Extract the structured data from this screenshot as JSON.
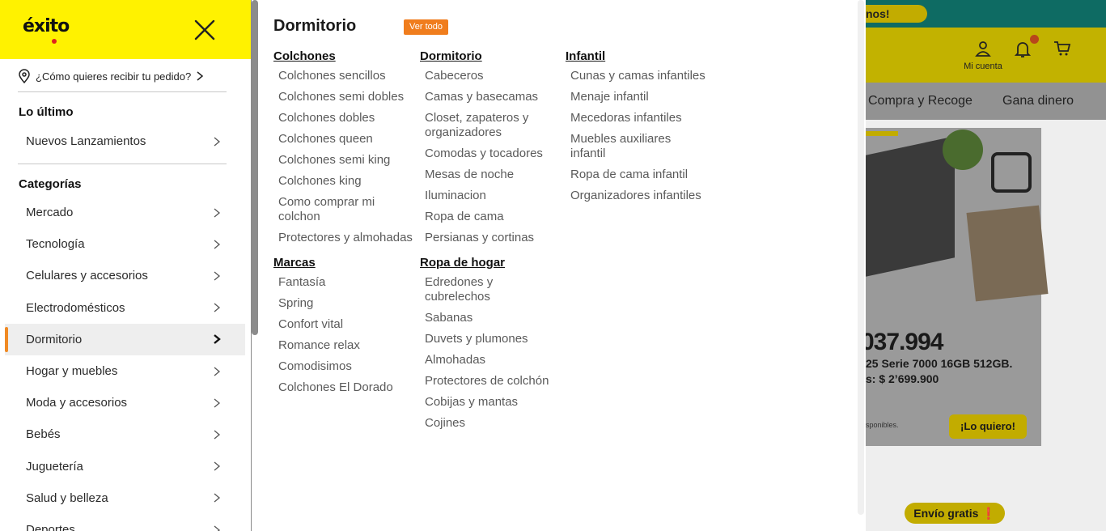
{
  "header": {
    "logo_text": "éxito"
  },
  "delivery": {
    "label": "¿Cómo quieres recibir tu pedido?"
  },
  "drawer": {
    "latest_title": "Lo último",
    "latest_items": [
      {
        "label": "Nuevos Lanzamientos"
      }
    ],
    "categories_title": "Categorías",
    "categories": [
      {
        "label": "Mercado"
      },
      {
        "label": "Tecnología"
      },
      {
        "label": "Celulares y accesorios"
      },
      {
        "label": "Electrodomésticos"
      },
      {
        "label": "Dormitorio",
        "active": true
      },
      {
        "label": "Hogar y muebles"
      },
      {
        "label": "Moda y accesorios"
      },
      {
        "label": "Bebés"
      },
      {
        "label": "Juguetería"
      },
      {
        "label": "Salud y belleza"
      },
      {
        "label": "Deportes"
      }
    ]
  },
  "panel": {
    "title": "Dormitorio",
    "see_all": "Ver todo",
    "columns": [
      [
        {
          "heading": "Colchones",
          "links": [
            "Colchones sencillos",
            "Colchones semi dobles",
            "Colchones dobles",
            "Colchones queen",
            "Colchones semi king",
            "Colchones king",
            "Como comprar mi colchon",
            "Protectores y almohadas"
          ]
        },
        {
          "heading": "Marcas",
          "links": [
            "Fantasía",
            "Spring",
            "Confort vital",
            "Romance relax",
            "Comodisimos",
            "Colchones El Dorado"
          ]
        }
      ],
      [
        {
          "heading": "Dormitorio",
          "links": [
            "Cabeceros",
            "Camas y basecamas",
            "Closet, zapateros y organizadores",
            "Comodas y tocadores",
            "Mesas de noche",
            "Iluminacion",
            "Ropa de cama",
            "Persianas y cortinas"
          ]
        },
        {
          "heading": "Ropa de hogar",
          "links": [
            "Edredones y cubrelechos",
            "Sabanas",
            "Duvets y plumones",
            "Almohadas",
            "Protectores de colchón",
            "Cobijas y mantas",
            "Cojines"
          ]
        }
      ],
      [
        {
          "heading": "Infantil",
          "links": [
            "Cunas y camas infantiles",
            "Menaje infantil",
            "Mecedoras infantiles",
            "Muebles auxiliares infantil",
            "Ropa de cama infantil",
            "Organizadores infantiles"
          ]
        }
      ]
    ]
  },
  "background": {
    "topbar_text": "nos!",
    "account_label": "Mi cuenta",
    "nav": [
      "Compra y Recoge",
      "Gana dinero"
    ],
    "banner_price": "037.994",
    "banner_desc": "25 Serie 7000 16GB 512GB.",
    "banner_desc2": "s: $ 2’699.900",
    "banner_small": "sponibles.",
    "banner_cta": "¡Lo quiero!",
    "shipping_badge": "Envío gratis"
  },
  "colors": {
    "brand_yellow": "#fff200",
    "accent_orange": "#f07d1d",
    "overlay_dim": "#8a8a8a"
  }
}
